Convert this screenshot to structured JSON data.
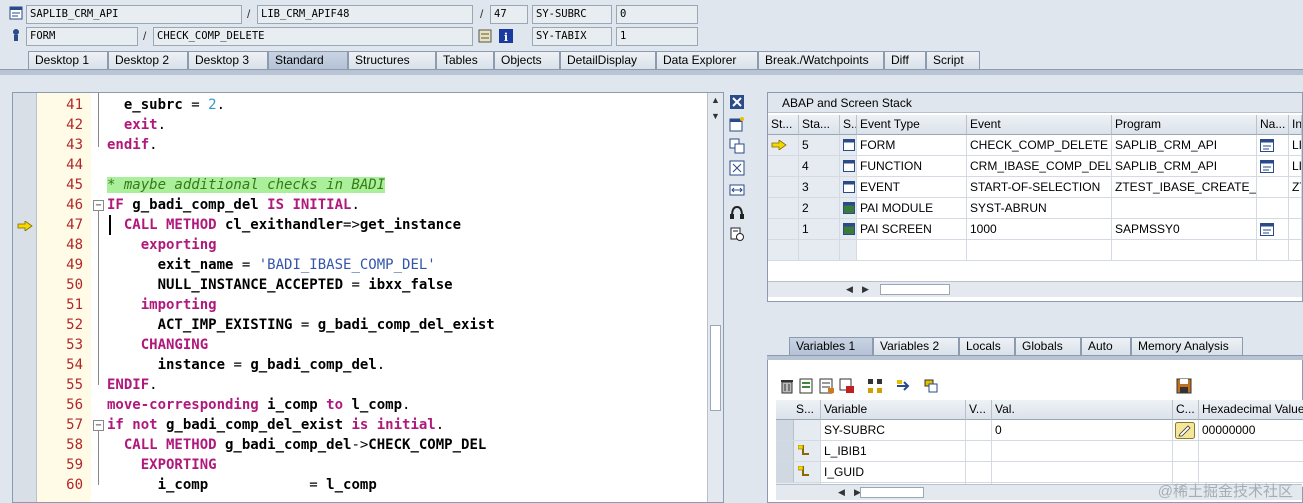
{
  "header": {
    "program_field": "SAPLIB_CRM_API",
    "include_field": "LIB_CRM_APIF48",
    "line_field": "47",
    "sysvar1_name": "SY-SUBRC",
    "sysvar1_value": "0",
    "event_type_field": "FORM",
    "event_field": "CHECK_COMP_DELETE",
    "sysvar2_name": "SY-TABIX",
    "sysvar2_value": "1",
    "slash": "/"
  },
  "tabs": [
    {
      "label": "Desktop 1"
    },
    {
      "label": "Desktop 2"
    },
    {
      "label": "Desktop 3"
    },
    {
      "label": "Standard",
      "active": true
    },
    {
      "label": "Structures"
    },
    {
      "label": "Tables"
    },
    {
      "label": "Objects"
    },
    {
      "label": "DetailDisplay"
    },
    {
      "label": "Data Explorer"
    },
    {
      "label": "Break./Watchpoints"
    },
    {
      "label": "Diff"
    },
    {
      "label": "Script"
    }
  ],
  "editor": {
    "current_line": 47,
    "lines": [
      {
        "n": "41",
        "tokens": [
          {
            "t": "  e_subrc",
            "c": "id"
          },
          {
            "t": " = ",
            "c": ""
          },
          {
            "t": "2",
            "c": "num"
          },
          {
            "t": ".",
            "c": ""
          }
        ]
      },
      {
        "n": "42",
        "tokens": [
          {
            "t": "  exit",
            "c": "kw"
          },
          {
            "t": ".",
            "c": ""
          }
        ]
      },
      {
        "n": "43",
        "tokens": [
          {
            "t": "endif",
            "c": "kw"
          },
          {
            "t": ".",
            "c": ""
          }
        ]
      },
      {
        "n": "44",
        "tokens": []
      },
      {
        "n": "45",
        "tokens": [
          {
            "t": "* maybe additional checks in BADI",
            "c": "cmt"
          }
        ]
      },
      {
        "n": "46",
        "tokens": [
          {
            "t": "IF",
            "c": "kw"
          },
          {
            "t": " g_badi_comp_del ",
            "c": "id"
          },
          {
            "t": "IS INITIAL",
            "c": "kw"
          },
          {
            "t": ".",
            "c": ""
          }
        ]
      },
      {
        "n": "47",
        "tokens": [
          {
            "t": "  CALL METHOD",
            "c": "kw"
          },
          {
            "t": " cl_exithandler",
            "c": "id"
          },
          {
            "t": "=>",
            "c": ""
          },
          {
            "t": "get_instance",
            "c": "id"
          }
        ]
      },
      {
        "n": "48",
        "tokens": [
          {
            "t": "    exporting",
            "c": "kw"
          }
        ]
      },
      {
        "n": "49",
        "tokens": [
          {
            "t": "      exit_name",
            "c": "id"
          },
          {
            "t": " = ",
            "c": ""
          },
          {
            "t": "'BADI_IBASE_COMP_DEL'",
            "c": "str"
          }
        ]
      },
      {
        "n": "50",
        "tokens": [
          {
            "t": "      NULL_INSTANCE_ACCEPTED",
            "c": "id"
          },
          {
            "t": " = ",
            "c": ""
          },
          {
            "t": "ibxx_false",
            "c": "id"
          }
        ]
      },
      {
        "n": "51",
        "tokens": [
          {
            "t": "    importing",
            "c": "kw"
          }
        ]
      },
      {
        "n": "52",
        "tokens": [
          {
            "t": "      ACT_IMP_EXISTING",
            "c": "id"
          },
          {
            "t": " = ",
            "c": ""
          },
          {
            "t": "g_badi_comp_del_exist",
            "c": "id"
          }
        ]
      },
      {
        "n": "53",
        "tokens": [
          {
            "t": "    CHANGING",
            "c": "kw"
          }
        ]
      },
      {
        "n": "54",
        "tokens": [
          {
            "t": "      instance",
            "c": "id"
          },
          {
            "t": " = ",
            "c": ""
          },
          {
            "t": "g_badi_comp_del",
            "c": "id"
          },
          {
            "t": ".",
            "c": ""
          }
        ]
      },
      {
        "n": "55",
        "tokens": [
          {
            "t": "ENDIF",
            "c": "kw"
          },
          {
            "t": ".",
            "c": ""
          }
        ]
      },
      {
        "n": "56",
        "tokens": [
          {
            "t": "move-corresponding",
            "c": "kw"
          },
          {
            "t": " i_comp ",
            "c": "id"
          },
          {
            "t": "to",
            "c": "kw"
          },
          {
            "t": " l_comp",
            "c": "id"
          },
          {
            "t": ".",
            "c": ""
          }
        ]
      },
      {
        "n": "57",
        "tokens": [
          {
            "t": "if not",
            "c": "kw"
          },
          {
            "t": " g_badi_comp_del_exist ",
            "c": "id"
          },
          {
            "t": "is initial",
            "c": "kw"
          },
          {
            "t": ".",
            "c": ""
          }
        ]
      },
      {
        "n": "58",
        "tokens": [
          {
            "t": "  CALL METHOD",
            "c": "kw"
          },
          {
            "t": " g_badi_comp_del",
            "c": "id"
          },
          {
            "t": "->",
            "c": ""
          },
          {
            "t": "CHECK_COMP_DEL",
            "c": "id"
          }
        ]
      },
      {
        "n": "59",
        "tokens": [
          {
            "t": "    EXPORTING",
            "c": "kw"
          }
        ]
      },
      {
        "n": "60",
        "tokens": [
          {
            "t": "      i_comp",
            "c": "id"
          },
          {
            "t": "            = ",
            "c": ""
          },
          {
            "t": "l_comp",
            "c": "id"
          }
        ]
      }
    ]
  },
  "stack": {
    "title": "ABAP and Screen Stack",
    "columns": [
      "St...",
      "Sta...",
      "S...",
      "Event Type",
      "Event",
      "Program",
      "Na...",
      "In"
    ],
    "rows": [
      {
        "level": "5",
        "type": "FORM",
        "event": "CHECK_COMP_DELETE",
        "program": "SAPLIB_CRM_API",
        "current": true,
        "nav": true,
        "include": "LI"
      },
      {
        "level": "4",
        "type": "FUNCTION",
        "event": "CRM_IBASE_COMP_DELE...",
        "program": "SAPLIB_CRM_API",
        "current": false,
        "nav": true,
        "include": "LI"
      },
      {
        "level": "3",
        "type": "EVENT",
        "event": "START-OF-SELECTION",
        "program": "ZTEST_IBASE_CREATE_...",
        "current": false,
        "nav": false,
        "include": "ZT"
      },
      {
        "level": "2",
        "type": "PAI MODULE",
        "event": "SYST-ABRUN",
        "program": "",
        "current": false,
        "nav": false,
        "include": ""
      },
      {
        "level": "1",
        "type": "PAI SCREEN",
        "event": "1000",
        "program": "SAPMSSY0",
        "current": false,
        "nav": true,
        "include": ""
      }
    ]
  },
  "var_tabs": [
    {
      "label": "Variables 1",
      "active": true
    },
    {
      "label": "Variables 2"
    },
    {
      "label": "Locals"
    },
    {
      "label": "Globals"
    },
    {
      "label": "Auto"
    },
    {
      "label": "Memory Analysis"
    }
  ],
  "vars": {
    "columns": [
      "S...",
      "Variable",
      "V...",
      "Val.",
      "C...",
      "Hexadecimal Value"
    ],
    "rows": [
      {
        "name": "SY-SUBRC",
        "value": "0",
        "hex": "00000000",
        "icon": ""
      },
      {
        "name": "L_IBIB1",
        "value": "",
        "hex": "",
        "icon": "struct"
      },
      {
        "name": "I_GUID",
        "value": "",
        "hex": "",
        "icon": "struct"
      }
    ]
  },
  "watermark": "@稀土掘金技术社区"
}
